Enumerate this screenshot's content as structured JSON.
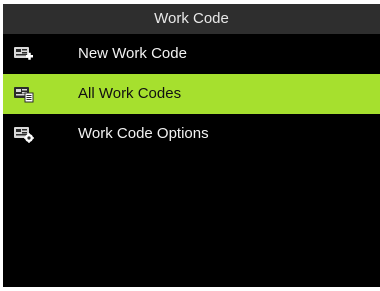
{
  "header": {
    "title": "Work Code"
  },
  "menu": {
    "items": [
      {
        "label": "New Work Code",
        "icon": "new-work-code-icon",
        "selected": false
      },
      {
        "label": "All Work Codes",
        "icon": "list-work-codes-icon",
        "selected": true
      },
      {
        "label": "Work Code Options",
        "icon": "work-code-options-icon",
        "selected": false
      }
    ]
  },
  "colors": {
    "title_bar": "#2e2e2e",
    "background": "#000000",
    "selected_row": "#a6e02e"
  }
}
